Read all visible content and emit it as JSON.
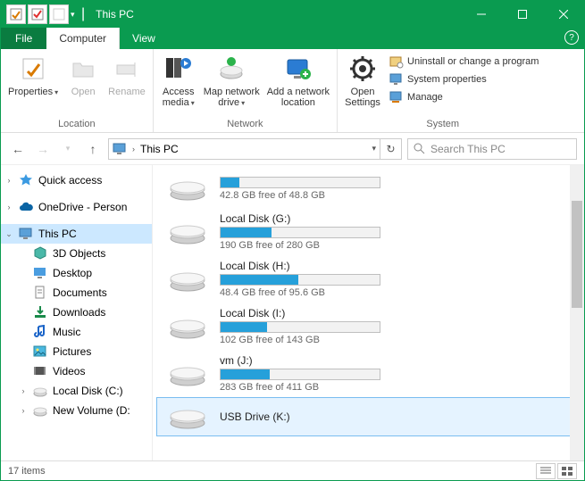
{
  "title": "This PC",
  "tabs": {
    "file": "File",
    "computer": "Computer",
    "view": "View"
  },
  "ribbon": {
    "location": {
      "label": "Location",
      "properties": "Properties",
      "open": "Open",
      "rename": "Rename"
    },
    "network": {
      "label": "Network",
      "access_media": "Access\nmedia",
      "map_network_drive": "Map network\ndrive",
      "add_network_location": "Add a network\nlocation"
    },
    "system": {
      "label": "System",
      "open_settings": "Open\nSettings",
      "uninstall": "Uninstall or change a program",
      "system_properties": "System properties",
      "manage": "Manage"
    }
  },
  "address": {
    "path": "This PC"
  },
  "search": {
    "placeholder": "Search This PC"
  },
  "sidebar": [
    {
      "label": "Quick access",
      "icon": "star",
      "indent": false,
      "exp": "›"
    },
    {
      "label": "OneDrive - Person",
      "icon": "cloud",
      "indent": false,
      "exp": "›"
    },
    {
      "label": "This PC",
      "icon": "pc",
      "indent": false,
      "selected": true,
      "exp": "⌄"
    },
    {
      "label": "3D Objects",
      "icon": "cube",
      "indent": true
    },
    {
      "label": "Desktop",
      "icon": "desktop",
      "indent": true
    },
    {
      "label": "Documents",
      "icon": "doc",
      "indent": true
    },
    {
      "label": "Downloads",
      "icon": "download",
      "indent": true
    },
    {
      "label": "Music",
      "icon": "music",
      "indent": true
    },
    {
      "label": "Pictures",
      "icon": "picture",
      "indent": true
    },
    {
      "label": "Videos",
      "icon": "video",
      "indent": true
    },
    {
      "label": "Local Disk (C:)",
      "icon": "disk",
      "indent": true,
      "exp": "›"
    },
    {
      "label": "New Volume (D:",
      "icon": "disk",
      "indent": true,
      "exp": "›"
    }
  ],
  "drives": [
    {
      "name": "",
      "free": "42.8 GB free of 48.8 GB",
      "fill": 12,
      "selected": false,
      "showbar": true,
      "topcrop": true
    },
    {
      "name": "Local Disk (G:)",
      "free": "190 GB free of 280 GB",
      "fill": 32,
      "selected": false,
      "showbar": true
    },
    {
      "name": "Local Disk (H:)",
      "free": "48.4 GB free of 95.6 GB",
      "fill": 49,
      "selected": false,
      "showbar": true
    },
    {
      "name": "Local Disk (I:)",
      "free": "102 GB free of 143 GB",
      "fill": 29,
      "selected": false,
      "showbar": true
    },
    {
      "name": "vm (J:)",
      "free": "283 GB free of 411 GB",
      "fill": 31,
      "selected": false,
      "showbar": true
    },
    {
      "name": "USB Drive (K:)",
      "free": "",
      "fill": 0,
      "selected": true,
      "showbar": false
    }
  ],
  "status": {
    "items": "17 items"
  },
  "colors": {
    "accent": "#0a9b50",
    "bar": "#26a0da"
  }
}
